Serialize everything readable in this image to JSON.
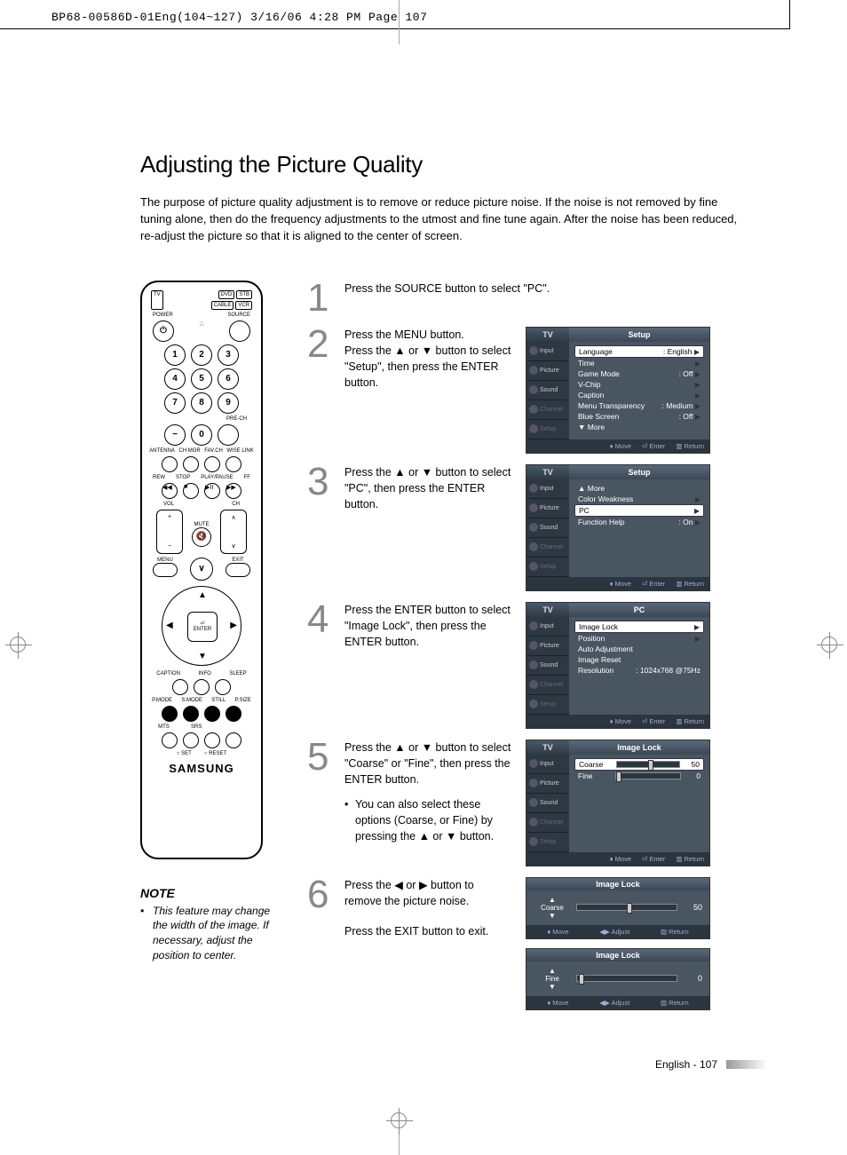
{
  "print_header": "BP68-00586D-01Eng(104~127)  3/16/06  4:28 PM  Page 107",
  "title": "Adjusting the Picture Quality",
  "intro": "The purpose of picture quality adjustment is to remove or reduce picture noise. If the noise is not removed by fine tuning alone, then do the frequency adjustments to the utmost and fine tune again. After the noise has been reduced, re-adjust the picture so that it is aligned to the center of screen.",
  "remote": {
    "brand": "SAMSUNG",
    "top_modes": [
      "TV",
      "DVD",
      "STB",
      "CABLE",
      "VCR"
    ],
    "power_label": "POWER",
    "source_label": "SOURCE",
    "numbers": [
      "1",
      "2",
      "3",
      "4",
      "5",
      "6",
      "7",
      "8",
      "9",
      "0"
    ],
    "dash": "−",
    "pre_ch": "PRE-CH",
    "row_labels_a": [
      "ANTENNA",
      "CH MGR",
      "FAV.CH",
      "WISE LINK"
    ],
    "transport": [
      "REW",
      "STOP",
      "PLAY/PAUSE",
      "FF"
    ],
    "vol": "VOL",
    "ch": "CH",
    "mute": "MUTE",
    "menu": "MENU",
    "exit": "EXIT",
    "enter": "ENTER",
    "row_labels_b": [
      "CAPTION",
      "INFO",
      "SLEEP"
    ],
    "row_labels_c": [
      "P.MODE",
      "S.MODE",
      "STILL",
      "P.SIZE"
    ],
    "row_labels_d": [
      "MTS",
      "SRS",
      "",
      ""
    ],
    "set_reset": [
      "SET",
      "RESET"
    ]
  },
  "steps": [
    {
      "n": "1",
      "text": "Press the SOURCE button to select \"PC\"."
    },
    {
      "n": "2",
      "text": "Press the MENU button.\nPress the ▲ or ▼ button to select \"Setup\", then press the ENTER button."
    },
    {
      "n": "3",
      "text": "Press the ▲ or ▼ button to select \"PC\", then press the ENTER button."
    },
    {
      "n": "4",
      "text": "Press the ENTER button to select \"Image Lock\", then press the ENTER button."
    },
    {
      "n": "5",
      "text": "Press the ▲ or ▼ button to select \"Coarse\" or \"Fine\", then press the ENTER button.",
      "bullet": "You can also select these options (Coarse, or Fine) by pressing the ▲ or ▼ button."
    },
    {
      "n": "6",
      "text": "Press the ◀ or ▶ button to remove the picture noise.",
      "extra": "Press the EXIT button to exit."
    }
  ],
  "osd_common": {
    "tab_tv": "TV",
    "nav": [
      "Input",
      "Picture",
      "Sound",
      "Channel",
      "Setup"
    ],
    "footer_move": "Move",
    "footer_enter": "Enter",
    "footer_return": "Return",
    "footer_adjust": "Adjust"
  },
  "osd2": {
    "title": "Setup",
    "rows": [
      {
        "label": "Language",
        "val": ": English",
        "sel": true
      },
      {
        "label": "Time",
        "val": ""
      },
      {
        "label": "Game Mode",
        "val": ": Off"
      },
      {
        "label": "V-Chip",
        "val": ""
      },
      {
        "label": "Caption",
        "val": ""
      },
      {
        "label": "Menu Transparency",
        "val": ": Medium"
      },
      {
        "label": "Blue Screen",
        "val": ": Off"
      },
      {
        "label": "▼ More",
        "val": "",
        "noarrow": true
      }
    ]
  },
  "osd3": {
    "title": "Setup",
    "rows": [
      {
        "label": "▲ More",
        "val": "",
        "noarrow": true
      },
      {
        "label": "Color Weakness",
        "val": ""
      },
      {
        "label": "PC",
        "val": "",
        "sel": true
      },
      {
        "label": "Function Help",
        "val": ": On"
      }
    ]
  },
  "osd4": {
    "title": "PC",
    "rows": [
      {
        "label": "Image Lock",
        "val": "",
        "sel": true
      },
      {
        "label": "Position",
        "val": ""
      },
      {
        "label": "Auto Adjustment",
        "val": "",
        "noarrow": true
      },
      {
        "label": "Image Reset",
        "val": "",
        "noarrow": true
      },
      {
        "label": "Resolution",
        "val": ": 1024x768 @75Hz",
        "noarrow": true
      }
    ]
  },
  "osd5": {
    "title": "Image Lock",
    "rows": [
      {
        "label": "Coarse",
        "slider": 50,
        "sel": true,
        "pos": 50
      },
      {
        "label": "Fine",
        "slider": 0,
        "pos": 0
      }
    ]
  },
  "osd6a": {
    "title": "Image Lock",
    "label": "Coarse",
    "value": 50,
    "pos": 50
  },
  "osd6b": {
    "title": "Image Lock",
    "label": "Fine",
    "value": 0,
    "pos": 2
  },
  "note": {
    "title": "NOTE",
    "body": "This feature may change the width of the image. If necessary, adjust the position to center."
  },
  "footer": {
    "lang": "English",
    "page": "107"
  }
}
